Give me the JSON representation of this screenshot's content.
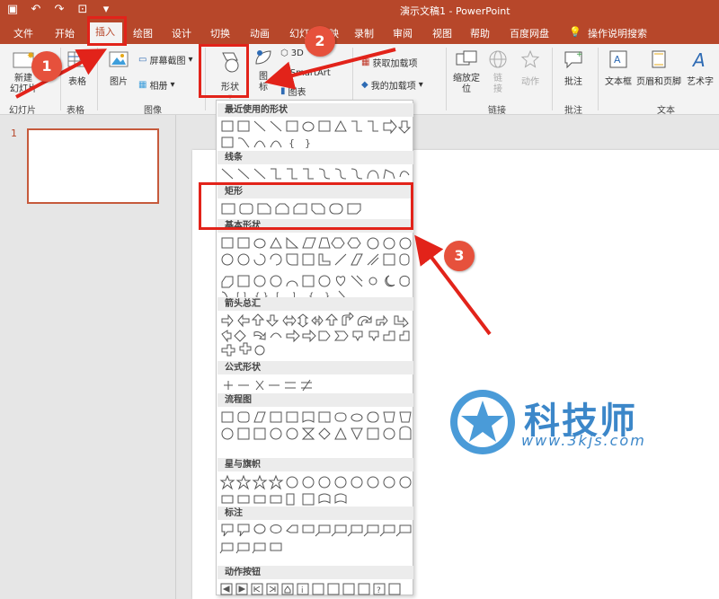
{
  "titlebar": {
    "doc_title": "演示文稿1 - PowerPoint",
    "qat": [
      "save-icon",
      "undo-icon",
      "redo-icon",
      "present-icon",
      "customize-icon"
    ]
  },
  "tabs": [
    {
      "label": "文件"
    },
    {
      "label": "开始"
    },
    {
      "label": "插入"
    },
    {
      "label": "绘图"
    },
    {
      "label": "设计"
    },
    {
      "label": "切换"
    },
    {
      "label": "动画"
    },
    {
      "label": "幻灯片放映"
    },
    {
      "label": "录制"
    },
    {
      "label": "审阅"
    },
    {
      "label": "视图"
    },
    {
      "label": "帮助"
    },
    {
      "label": "百度网盘"
    },
    {
      "label": "操作说明搜索"
    }
  ],
  "ribbon": {
    "new_slide": "新建\n幻灯片",
    "table": "表格",
    "picture": "图片",
    "screenshot": "屏幕截图",
    "album": "相册",
    "shapes": "形状",
    "icons": "图\n标",
    "model3d": "3D",
    "smartart": "SmartArt",
    "chart": "图表",
    "get_addins": "获取加载项",
    "my_addins": "我的加载项",
    "zoom": "缩放定\n位",
    "link": "链\n接",
    "action": "动作",
    "comment": "批注",
    "textbox": "文本框",
    "header_footer": "页眉和页脚",
    "wordart": "艺术字",
    "groups": {
      "slides": "幻灯片",
      "tables": "表格",
      "images": "图像",
      "links": "链接",
      "comments": "批注",
      "text": "文本"
    }
  },
  "slides": {
    "number": "1"
  },
  "shapes_menu": {
    "sections": [
      {
        "title": "最近使用的形状"
      },
      {
        "title": "线条"
      },
      {
        "title": "矩形"
      },
      {
        "title": "基本形状"
      },
      {
        "title": "箭头总汇"
      },
      {
        "title": "公式形状"
      },
      {
        "title": "流程图"
      },
      {
        "title": "星与旗帜"
      },
      {
        "title": "标注"
      },
      {
        "title": "动作按钮"
      }
    ]
  },
  "annotations": {
    "badge1": "1",
    "badge2": "2",
    "badge3": "3"
  },
  "watermark": {
    "name": "科技师",
    "url": "www.3kjs.com"
  },
  "colors": {
    "accent": "#b7472a",
    "highlight": "#e2231a",
    "badge": "#e6513c",
    "watermark": "#3c87c9"
  }
}
